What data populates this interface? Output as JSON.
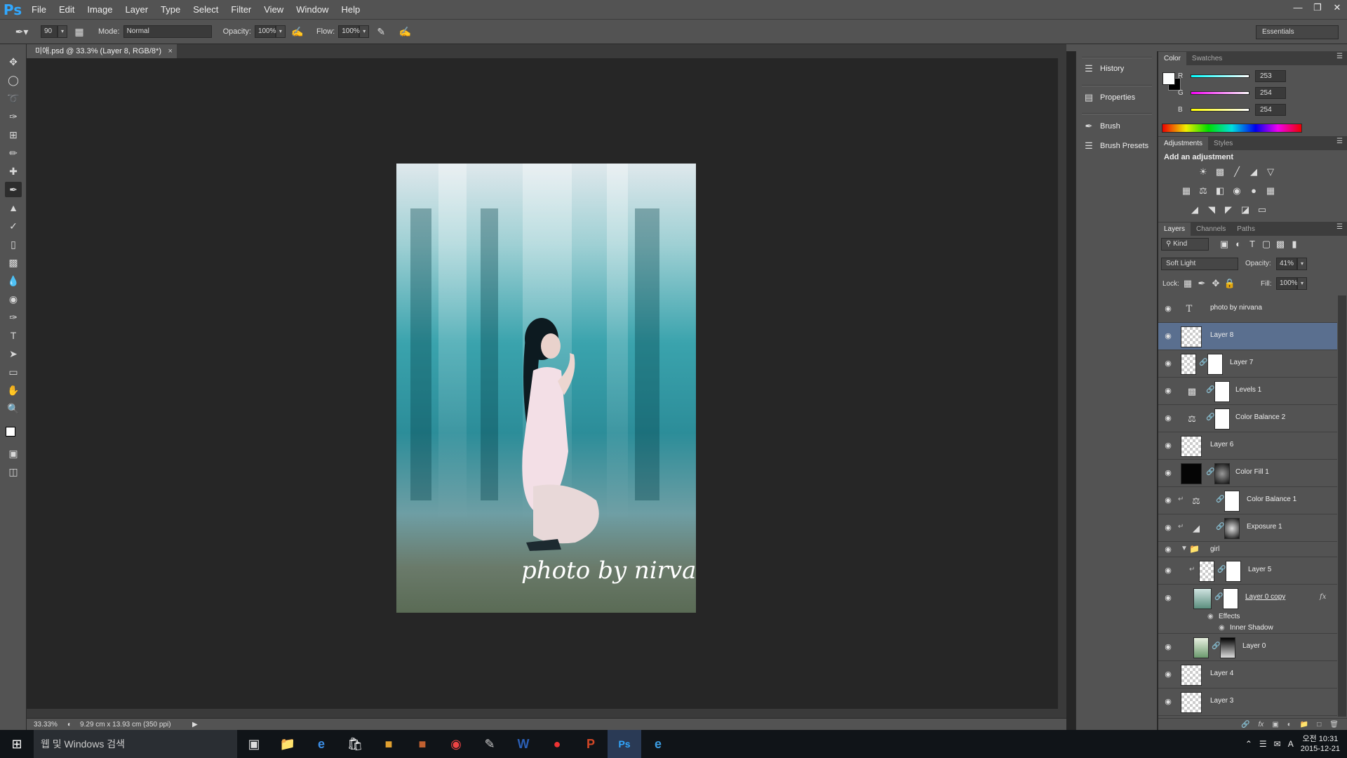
{
  "app": {
    "logo": "Ps"
  },
  "menu": [
    "File",
    "Edit",
    "Image",
    "Layer",
    "Type",
    "Select",
    "Filter",
    "View",
    "Window",
    "Help"
  ],
  "options": {
    "brush_size": "90",
    "mode_label": "Mode:",
    "mode_value": "Normal",
    "opacity_label": "Opacity:",
    "opacity_value": "100%",
    "flow_label": "Flow:",
    "flow_value": "100%",
    "workspace": "Essentials"
  },
  "document": {
    "tab_title": "미애.psd @ 33.3% (Layer 8, RGB/8*)",
    "caption": "photo by nirvana",
    "zoom": "33.33%",
    "doc_size": "9.29 cm x 13.93 cm (350 ppi)"
  },
  "mini_panels": [
    "History",
    "Properties",
    "Brush",
    "Brush Presets"
  ],
  "color_panel": {
    "tabs": [
      "Color",
      "Swatches"
    ],
    "channels": [
      {
        "label": "R",
        "value": "253"
      },
      {
        "label": "G",
        "value": "254"
      },
      {
        "label": "B",
        "value": "254"
      }
    ]
  },
  "adjustments_panel": {
    "tabs": [
      "Adjustments",
      "Styles"
    ],
    "heading": "Add an adjustment"
  },
  "layers_panel": {
    "tabs": [
      "Layers",
      "Channels",
      "Paths"
    ],
    "filter_kind": "Kind",
    "blend_mode": "Soft Light",
    "opacity_label": "Opacity:",
    "opacity_value": "41%",
    "lock_label": "Lock:",
    "fill_label": "Fill:",
    "fill_value": "100%",
    "layers": [
      {
        "name": "photo by nirvana"
      },
      {
        "name": "Layer 8"
      },
      {
        "name": "Layer 7"
      },
      {
        "name": "Levels 1"
      },
      {
        "name": "Color Balance 2"
      },
      {
        "name": "Layer 6"
      },
      {
        "name": "Color Fill 1"
      },
      {
        "name": "Color Balance 1"
      },
      {
        "name": "Exposure 1"
      },
      {
        "name": "girl"
      },
      {
        "name": "Layer 5"
      },
      {
        "name": "Layer 0 copy"
      },
      {
        "name": "Effects"
      },
      {
        "name": "Inner Shadow"
      },
      {
        "name": "Layer 0"
      },
      {
        "name": "Layer 4"
      },
      {
        "name": "Layer 3"
      }
    ]
  },
  "taskbar": {
    "search_placeholder": "웹 및 Windows 검색",
    "time": "오전 10:31",
    "date": "2015-12-21",
    "ime": "A"
  }
}
